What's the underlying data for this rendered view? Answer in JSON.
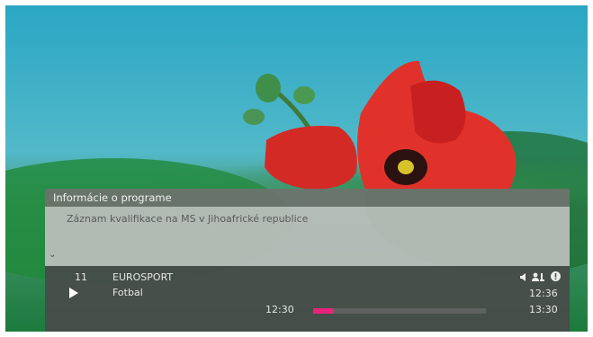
{
  "overlay": {
    "header_title": "Informácie o programe",
    "description": "Záznam kvalifikace na MS v Jihoafrické republice"
  },
  "channel": {
    "number": "11",
    "name": "EUROSPORT",
    "program": "Fotbal",
    "current_time": "12:36",
    "start_time": "12:30",
    "end_time": "13:30",
    "progress": 0.12
  },
  "icons": [
    "speaker-icon",
    "people-icon",
    "info-icon",
    "play-icon",
    "chevron-down-icon"
  ],
  "colors": {
    "progress": "#e8237a"
  }
}
